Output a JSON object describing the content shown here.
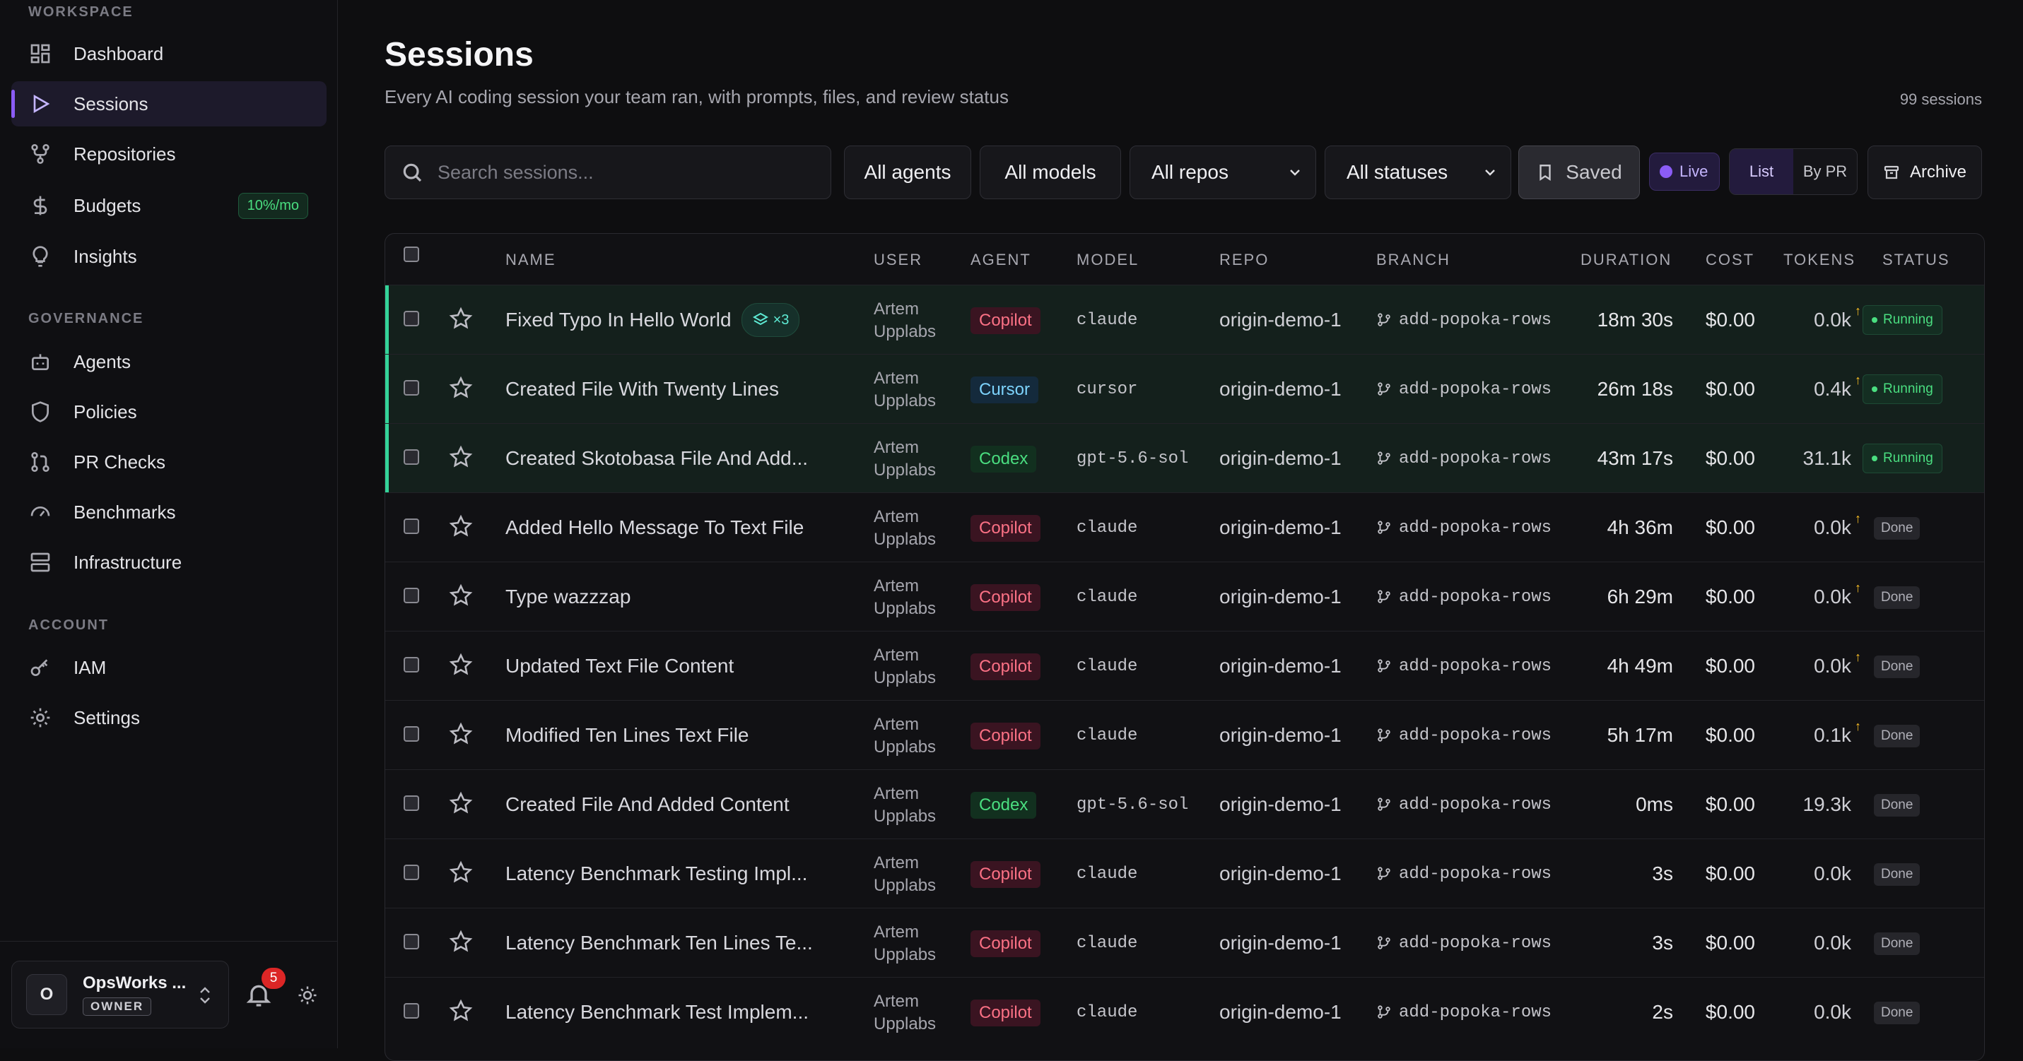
{
  "sidebar": {
    "sections": {
      "workspace": "WORKSPACE",
      "governance": "GOVERNANCE",
      "account": "ACCOUNT"
    },
    "items": [
      {
        "label": "Dashboard",
        "icon": "dashboard-icon"
      },
      {
        "label": "Sessions",
        "icon": "play-icon",
        "active": true
      },
      {
        "label": "Repositories",
        "icon": "repositories-icon"
      },
      {
        "label": "Budgets",
        "icon": "dollar-icon",
        "badge": "10%/mo"
      },
      {
        "label": "Insights",
        "icon": "lightbulb-icon"
      },
      {
        "label": "Agents",
        "icon": "bot-icon"
      },
      {
        "label": "Policies",
        "icon": "shield-icon"
      },
      {
        "label": "PR Checks",
        "icon": "pull-request-icon"
      },
      {
        "label": "Benchmarks",
        "icon": "gauge-icon"
      },
      {
        "label": "Infrastructure",
        "icon": "server-icon"
      },
      {
        "label": "IAM",
        "icon": "key-icon"
      },
      {
        "label": "Settings",
        "icon": "gear-icon"
      }
    ],
    "account": {
      "initial": "O",
      "name": "OpsWorks ...",
      "role": "OWNER"
    },
    "notifications": "5"
  },
  "header": {
    "title": "Sessions",
    "subtitle": "Every AI coding session your team ran, with prompts, files, and review status",
    "count": "99 sessions"
  },
  "toolbar": {
    "search_placeholder": "Search sessions...",
    "agents": "All agents",
    "models": "All models",
    "repos": "All repos",
    "statuses": "All statuses",
    "saved": "Saved",
    "live": "Live",
    "view_list": "List",
    "view_by_pr": "By PR",
    "archive": "Archive"
  },
  "table": {
    "columns": [
      "NAME",
      "USER",
      "AGENT",
      "MODEL",
      "REPO",
      "BRANCH",
      "DURATION",
      "COST",
      "TOKENS",
      "STATUS"
    ],
    "rows": [
      {
        "name": "Fixed Typo In Hello World",
        "badge": "×3",
        "user1": "Artem",
        "user2": "Upplabs",
        "agent": "Copilot",
        "model": "claude",
        "repo": "origin-demo-1",
        "branch": "add-popoka-rows",
        "duration": "18m 30s",
        "cost": "$0.00",
        "tokens": "0.0k",
        "tok_up": "↑",
        "status": "Running"
      },
      {
        "name": "Created File With Twenty Lines",
        "user1": "Artem",
        "user2": "Upplabs",
        "agent": "Cursor",
        "model": "cursor",
        "repo": "origin-demo-1",
        "branch": "add-popoka-rows",
        "duration": "26m 18s",
        "cost": "$0.00",
        "tokens": "0.4k",
        "tok_up": "↑",
        "status": "Running"
      },
      {
        "name": "Created Skotobasa File And Add...",
        "user1": "Artem",
        "user2": "Upplabs",
        "agent": "Codex",
        "model": "gpt-5.6-sol",
        "repo": "origin-demo-1",
        "branch": "add-popoka-rows",
        "duration": "43m 17s",
        "cost": "$0.00",
        "tokens": "31.1k",
        "status": "Running"
      },
      {
        "name": "Added Hello Message To Text File",
        "user1": "Artem",
        "user2": "Upplabs",
        "agent": "Copilot",
        "model": "claude",
        "repo": "origin-demo-1",
        "branch": "add-popoka-rows",
        "duration": "4h 36m",
        "cost": "$0.00",
        "tokens": "0.0k",
        "tok_up": "↑",
        "status": "Done"
      },
      {
        "name": "Type wazzzap",
        "user1": "Artem",
        "user2": "Upplabs",
        "agent": "Copilot",
        "model": "claude",
        "repo": "origin-demo-1",
        "branch": "add-popoka-rows",
        "duration": "6h 29m",
        "cost": "$0.00",
        "tokens": "0.0k",
        "tok_up": "↑",
        "status": "Done"
      },
      {
        "name": "Updated Text File Content",
        "user1": "Artem",
        "user2": "Upplabs",
        "agent": "Copilot",
        "model": "claude",
        "repo": "origin-demo-1",
        "branch": "add-popoka-rows",
        "duration": "4h 49m",
        "cost": "$0.00",
        "tokens": "0.0k",
        "tok_up": "↑",
        "status": "Done"
      },
      {
        "name": "Modified Ten Lines Text File",
        "user1": "Artem",
        "user2": "Upplabs",
        "agent": "Copilot",
        "model": "claude",
        "repo": "origin-demo-1",
        "branch": "add-popoka-rows",
        "duration": "5h 17m",
        "cost": "$0.00",
        "tokens": "0.1k",
        "tok_up": "↑",
        "status": "Done"
      },
      {
        "name": "Created File And Added Content",
        "user1": "Artem",
        "user2": "Upplabs",
        "agent": "Codex",
        "model": "gpt-5.6-sol",
        "repo": "origin-demo-1",
        "branch": "add-popoka-rows",
        "duration": "0ms",
        "cost": "$0.00",
        "tokens": "19.3k",
        "status": "Done"
      },
      {
        "name": "Latency Benchmark Testing Impl...",
        "user1": "Artem",
        "user2": "Upplabs",
        "agent": "Copilot",
        "model": "claude",
        "repo": "origin-demo-1",
        "branch": "add-popoka-rows",
        "duration": "3s",
        "cost": "$0.00",
        "tokens": "0.0k",
        "status": "Done"
      },
      {
        "name": "Latency Benchmark Ten Lines Te...",
        "user1": "Artem",
        "user2": "Upplabs",
        "agent": "Copilot",
        "model": "claude",
        "repo": "origin-demo-1",
        "branch": "add-popoka-rows",
        "duration": "3s",
        "cost": "$0.00",
        "tokens": "0.0k",
        "status": "Done"
      },
      {
        "name": "Latency Benchmark Test Implem...",
        "user1": "Artem",
        "user2": "Upplabs",
        "agent": "Copilot",
        "model": "claude",
        "repo": "origin-demo-1",
        "branch": "add-popoka-rows",
        "duration": "2s",
        "cost": "$0.00",
        "tokens": "0.0k",
        "status": "Done"
      }
    ]
  },
  "colors": {
    "accent": "#8b5cf6",
    "running": "#34d399",
    "copilot": "#fb7185",
    "cursor": "#7dd3fc",
    "codex": "#4ade80"
  }
}
